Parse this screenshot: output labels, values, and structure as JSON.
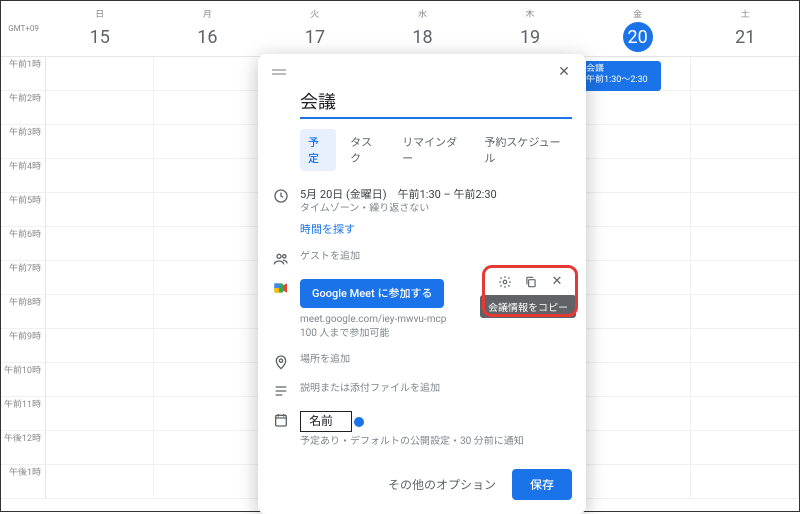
{
  "timezone_label": "GMT+09",
  "days": [
    {
      "dow": "日",
      "num": "15"
    },
    {
      "dow": "月",
      "num": "16"
    },
    {
      "dow": "火",
      "num": "17"
    },
    {
      "dow": "水",
      "num": "18"
    },
    {
      "dow": "木",
      "num": "19"
    },
    {
      "dow": "金",
      "num": "20",
      "today": true
    },
    {
      "dow": "土",
      "num": "21"
    }
  ],
  "hours": [
    "午前1時",
    "午前2時",
    "午前3時",
    "午前4時",
    "午前5時",
    "午前6時",
    "午前7時",
    "午前8時",
    "午前9時",
    "午前10時",
    "午前11時",
    "午後12時",
    "午後1時"
  ],
  "event_block": {
    "title": "会議",
    "time": "午前1:30〜2:30"
  },
  "modal": {
    "title": "会議",
    "tabs": {
      "event": "予定",
      "task": "タスク",
      "reminder": "リマインダー",
      "appointment": "予約スケジュール"
    },
    "datetime": {
      "main": "5月 20日 (金曜日)　午前1:30 – 午前2:30",
      "sub": "タイムゾーン・繰り返さない",
      "find_time": "時間を探す"
    },
    "guests_placeholder": "ゲストを追加",
    "meet": {
      "button": "Google Meet に参加する",
      "link": "meet.google.com/iey-mwvu-mcp",
      "limit": "100 人まで参加可能",
      "tooltip": "会議情報をコピー"
    },
    "location_placeholder": "場所を追加",
    "description_placeholder": "説明または添付ファイルを追加",
    "owner": {
      "name": "名前",
      "sub": "予定あり・デフォルトの公開設定・30 分前に通知"
    },
    "footer": {
      "more_options": "その他のオプション",
      "save": "保存"
    }
  }
}
